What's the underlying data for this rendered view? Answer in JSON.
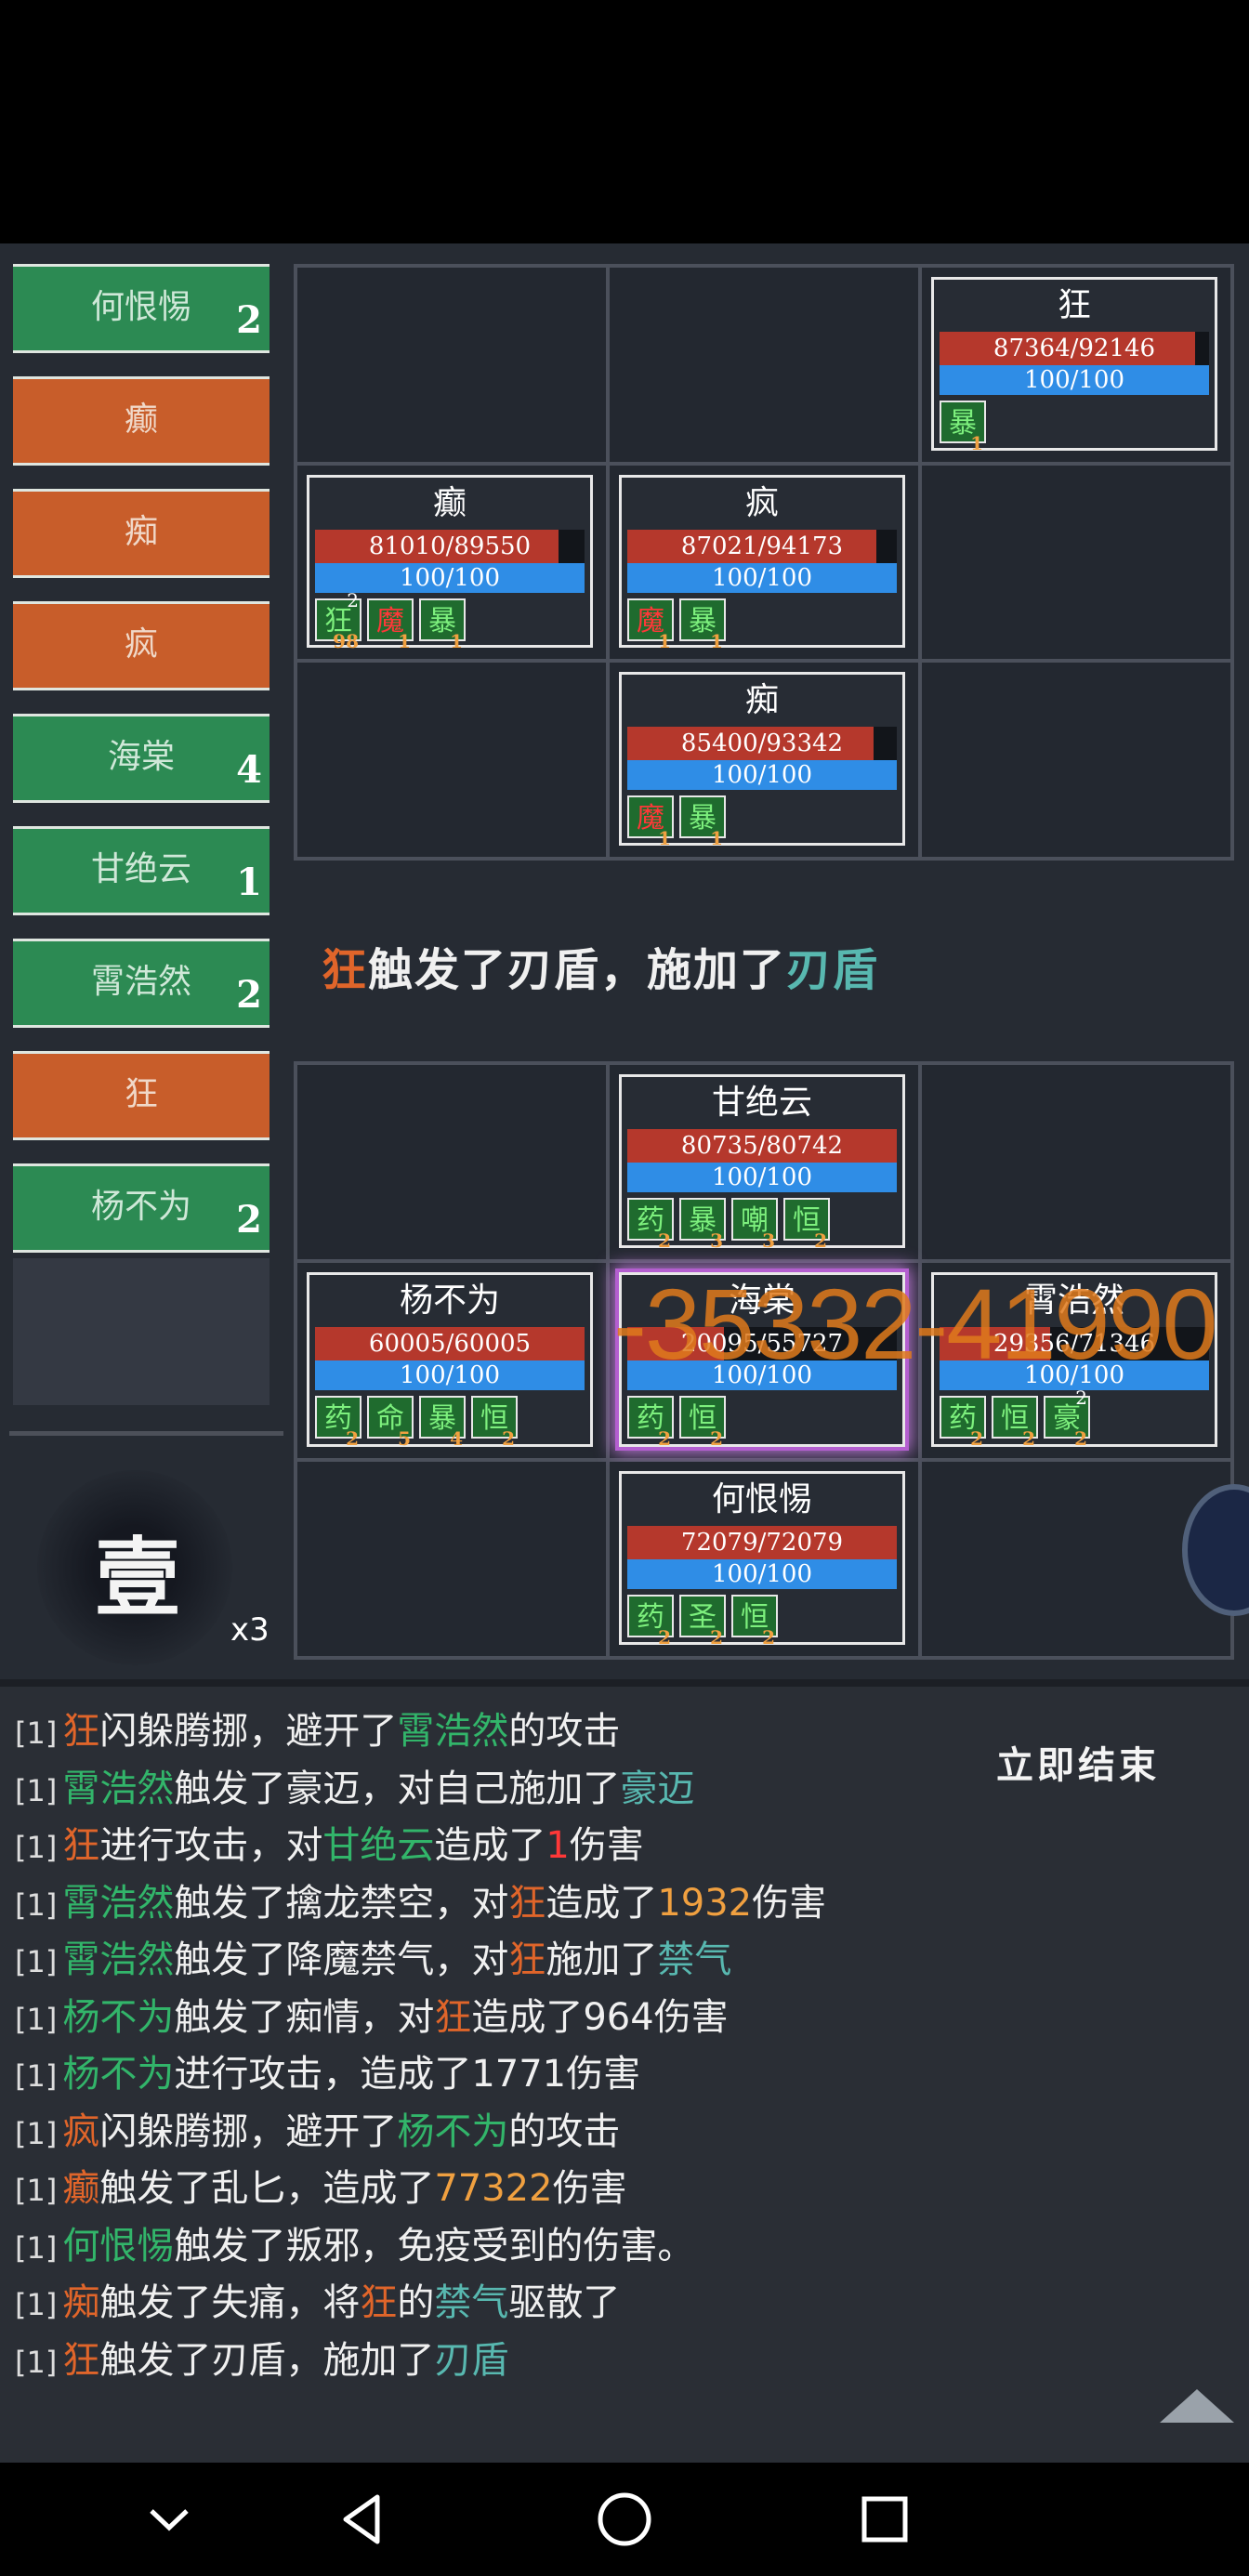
{
  "turn_order": [
    {
      "name": "何恨惕",
      "side": "player",
      "count": "2"
    },
    {
      "name": "癫",
      "side": "enemy",
      "count": ""
    },
    {
      "name": "痴",
      "side": "enemy",
      "count": ""
    },
    {
      "name": "疯",
      "side": "enemy",
      "count": ""
    },
    {
      "name": "海棠",
      "side": "player",
      "count": "4"
    },
    {
      "name": "甘绝云",
      "side": "player",
      "count": "1"
    },
    {
      "name": "霄浩然",
      "side": "player",
      "count": "2"
    },
    {
      "name": "狂",
      "side": "enemy",
      "count": ""
    },
    {
      "name": "杨不为",
      "side": "player",
      "count": "2"
    }
  ],
  "round": {
    "label": "壹",
    "speed": "x3"
  },
  "enemy_units": [
    {
      "cell": 2,
      "name": "狂",
      "hp": "87364/92146",
      "hp_ratio": 0.948,
      "mp": "100/100",
      "buffs": [
        {
          "ch": "暴",
          "n": "1",
          "top": "",
          "bad": false
        }
      ]
    },
    {
      "cell": 3,
      "name": "癫",
      "hp": "81010/89550",
      "hp_ratio": 0.905,
      "mp": "100/100",
      "buffs": [
        {
          "ch": "狂",
          "n": "98",
          "top": "2",
          "bad": false
        },
        {
          "ch": "魔",
          "n": "1",
          "top": "",
          "bad": true
        },
        {
          "ch": "暴",
          "n": "1",
          "top": "",
          "bad": false
        }
      ]
    },
    {
      "cell": 4,
      "name": "疯",
      "hp": "87021/94173",
      "hp_ratio": 0.924,
      "mp": "100/100",
      "buffs": [
        {
          "ch": "魔",
          "n": "1",
          "top": "",
          "bad": true
        },
        {
          "ch": "暴",
          "n": "1",
          "top": "",
          "bad": false
        }
      ]
    },
    {
      "cell": 7,
      "name": "痴",
      "hp": "85400/93342",
      "hp_ratio": 0.915,
      "mp": "100/100",
      "buffs": [
        {
          "ch": "魔",
          "n": "1",
          "top": "",
          "bad": true
        },
        {
          "ch": "暴",
          "n": "1",
          "top": "",
          "bad": false
        }
      ]
    }
  ],
  "ally_units": [
    {
      "cell": 1,
      "name": "甘绝云",
      "hp": "80735/80742",
      "hp_ratio": 0.999,
      "mp": "100/100",
      "selected": false,
      "buffs": [
        {
          "ch": "药",
          "n": "2",
          "top": "",
          "bad": false
        },
        {
          "ch": "暴",
          "n": "3",
          "top": "",
          "bad": false
        },
        {
          "ch": "嘲",
          "n": "3",
          "top": "",
          "bad": false
        },
        {
          "ch": "恒",
          "n": "2",
          "top": "",
          "bad": false
        }
      ]
    },
    {
      "cell": 3,
      "name": "杨不为",
      "hp": "60005/60005",
      "hp_ratio": 1.0,
      "mp": "100/100",
      "selected": false,
      "buffs": [
        {
          "ch": "药",
          "n": "2",
          "top": "",
          "bad": false
        },
        {
          "ch": "命",
          "n": "5",
          "top": "",
          "bad": false
        },
        {
          "ch": "暴",
          "n": "4",
          "top": "",
          "bad": false
        },
        {
          "ch": "恒",
          "n": "2",
          "top": "",
          "bad": false
        }
      ]
    },
    {
      "cell": 4,
      "name": "海棠",
      "hp": "20095/55727",
      "hp_ratio": 0.36,
      "mp": "100/100",
      "selected": true,
      "buffs": [
        {
          "ch": "药",
          "n": "2",
          "top": "",
          "bad": false
        },
        {
          "ch": "恒",
          "n": "2",
          "top": "",
          "bad": false
        }
      ]
    },
    {
      "cell": 5,
      "name": "霄浩然",
      "hp": "29356/71346",
      "hp_ratio": 0.41,
      "mp": "100/100",
      "selected": false,
      "buffs": [
        {
          "ch": "药",
          "n": "2",
          "top": "",
          "bad": false
        },
        {
          "ch": "恒",
          "n": "2",
          "top": "",
          "bad": false
        },
        {
          "ch": "豪",
          "n": "2",
          "top": "2",
          "bad": false
        }
      ]
    },
    {
      "cell": 7,
      "name": "何恨惕",
      "hp": "72079/72079",
      "hp_ratio": 1.0,
      "mp": "100/100",
      "selected": false,
      "buffs": [
        {
          "ch": "药",
          "n": "2",
          "top": "",
          "bad": false
        },
        {
          "ch": "圣",
          "n": "2",
          "top": "",
          "bad": false
        },
        {
          "ch": "恒",
          "n": "2",
          "top": "",
          "bad": false
        }
      ]
    }
  ],
  "announcement": [
    {
      "text": "狂",
      "c": "o"
    },
    {
      "text": "触发了刃盾，施加了",
      "c": "w"
    },
    {
      "text": "刃盾",
      "c": "t"
    }
  ],
  "damage_popup": "-35332-41990",
  "end_button": "立即结束",
  "log_prefix": "[1]",
  "log": [
    [
      {
        "text": "狂",
        "c": "o"
      },
      {
        "text": "闪躲腾挪，避开了",
        "c": "w"
      },
      {
        "text": "霄浩然",
        "c": "g"
      },
      {
        "text": "的攻击",
        "c": "w"
      }
    ],
    [
      {
        "text": "霄浩然",
        "c": "g"
      },
      {
        "text": "触发了豪迈，对自己施加了",
        "c": "w"
      },
      {
        "text": "豪迈",
        "c": "t"
      }
    ],
    [
      {
        "text": "狂",
        "c": "o"
      },
      {
        "text": "进行攻击，对",
        "c": "w"
      },
      {
        "text": "甘绝云",
        "c": "g"
      },
      {
        "text": "造成了",
        "c": "w"
      },
      {
        "text": "1",
        "c": "r"
      },
      {
        "text": "伤害",
        "c": "w"
      }
    ],
    [
      {
        "text": "霄浩然",
        "c": "g"
      },
      {
        "text": "触发了擒龙禁空，对",
        "c": "w"
      },
      {
        "text": "狂",
        "c": "o"
      },
      {
        "text": "造成了",
        "c": "w"
      },
      {
        "text": "1932",
        "c": "y"
      },
      {
        "text": "伤害",
        "c": "w"
      }
    ],
    [
      {
        "text": "霄浩然",
        "c": "g"
      },
      {
        "text": "触发了降魔禁气，对",
        "c": "w"
      },
      {
        "text": "狂",
        "c": "o"
      },
      {
        "text": "施加了",
        "c": "w"
      },
      {
        "text": "禁气",
        "c": "t"
      }
    ],
    [
      {
        "text": "杨不为",
        "c": "g"
      },
      {
        "text": "触发了痴情，对",
        "c": "w"
      },
      {
        "text": "狂",
        "c": "o"
      },
      {
        "text": "造成了964伤害",
        "c": "w"
      }
    ],
    [
      {
        "text": "杨不为",
        "c": "g"
      },
      {
        "text": "进行攻击，造成了1771伤害",
        "c": "w"
      }
    ],
    [
      {
        "text": "疯",
        "c": "o"
      },
      {
        "text": "闪躲腾挪，避开了",
        "c": "w"
      },
      {
        "text": "杨不为",
        "c": "g"
      },
      {
        "text": "的攻击",
        "c": "w"
      }
    ],
    [
      {
        "text": "癫",
        "c": "o"
      },
      {
        "text": "触发了乱匕，造成了",
        "c": "w"
      },
      {
        "text": "77322",
        "c": "y"
      },
      {
        "text": "伤害",
        "c": "w"
      }
    ],
    [
      {
        "text": "何恨惕",
        "c": "g"
      },
      {
        "text": "触发了叛邪，免疫受到的伤害。",
        "c": "w"
      }
    ],
    [
      {
        "text": "痴",
        "c": "o"
      },
      {
        "text": "触发了失痛，将",
        "c": "w"
      },
      {
        "text": "狂",
        "c": "o"
      },
      {
        "text": "的",
        "c": "w"
      },
      {
        "text": "禁气",
        "c": "t"
      },
      {
        "text": "驱散了",
        "c": "w"
      }
    ],
    [
      {
        "text": "狂",
        "c": "o"
      },
      {
        "text": "触发了刃盾，施加了",
        "c": "w"
      },
      {
        "text": "刃盾",
        "c": "t"
      }
    ]
  ],
  "nav": [
    "back-icon",
    "home-icon",
    "recents-icon"
  ],
  "colors": {
    "player": "#2c8a53",
    "enemy": "#c85d2a",
    "hp": "#b5382c",
    "mp": "#2f8de6",
    "highlight": "#b45fd0"
  }
}
